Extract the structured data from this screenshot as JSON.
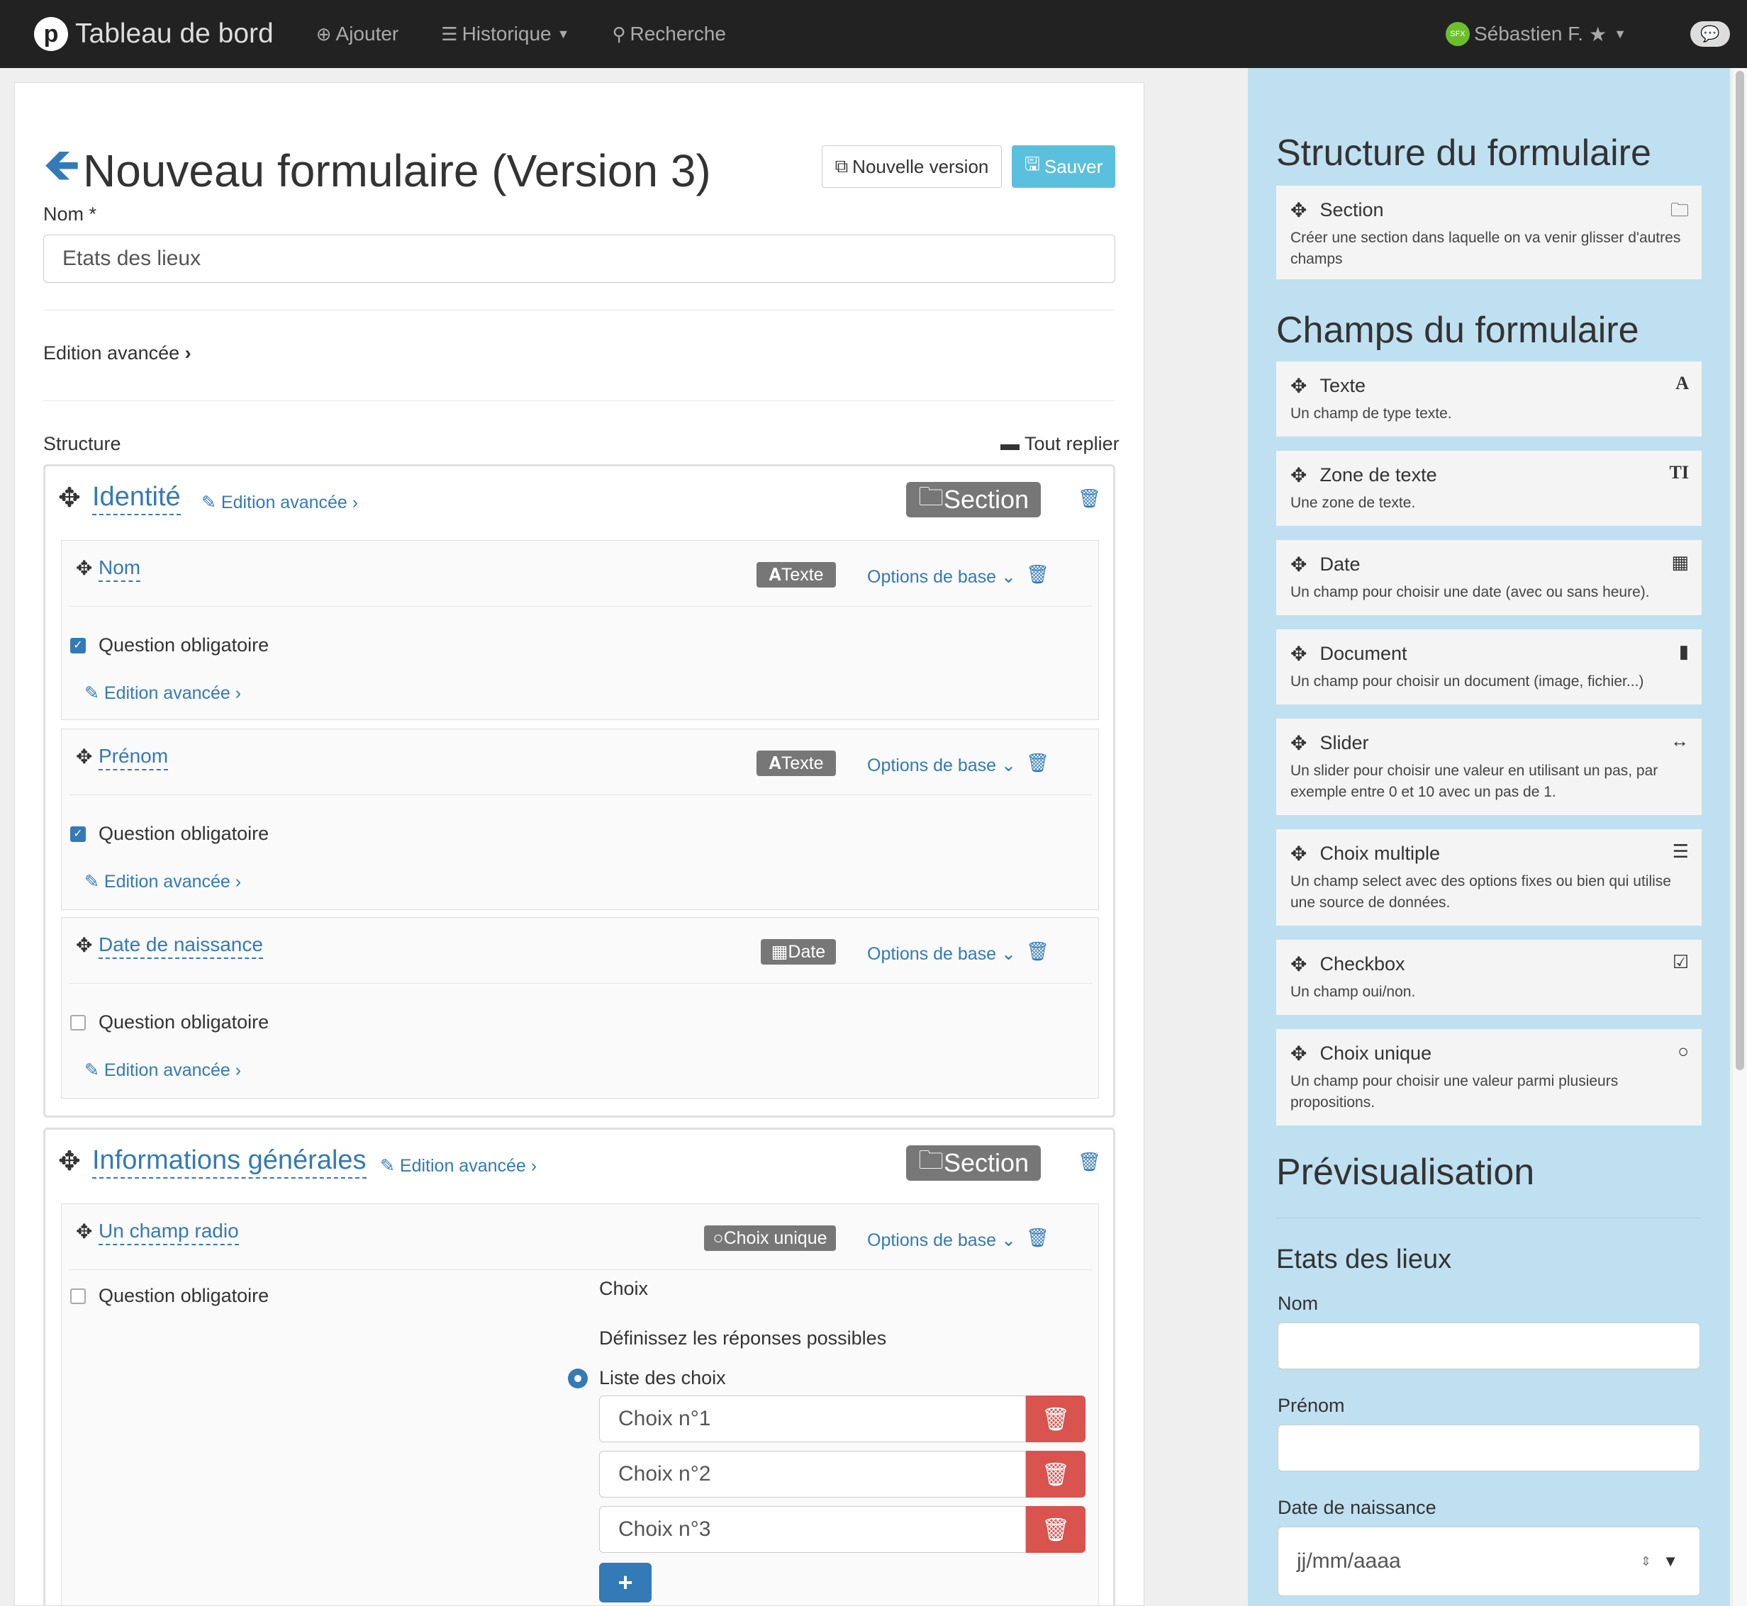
{
  "nav": {
    "brand": "Tableau de bord",
    "add": "Ajouter",
    "history": "Historique",
    "search": "Recherche",
    "user": "Sébastien F.",
    "avatar": "SFX"
  },
  "page": {
    "title": "Nouveau formulaire (Version 3)",
    "new_version": "Nouvelle version",
    "save": "Sauver",
    "name_label": "Nom",
    "name_required": "*",
    "name_value": "Etats des lieux",
    "advanced": "Edition avancée",
    "structure": "Structure",
    "collapse_all": "Tout replier"
  },
  "sections": [
    {
      "title": "Identité",
      "advanced": "Edition avancée",
      "badge": "Section",
      "fields": [
        {
          "name": "Nom",
          "type": "Texte",
          "options": "Options de base",
          "required_label": "Question obligatoire",
          "required": true,
          "advanced": "Edition avancée"
        },
        {
          "name": "Prénom",
          "type": "Texte",
          "options": "Options de base",
          "required_label": "Question obligatoire",
          "required": true,
          "advanced": "Edition avancée"
        },
        {
          "name": "Date de naissance",
          "type": "Date",
          "options": "Options de base",
          "required_label": "Question obligatoire",
          "required": false,
          "advanced": "Edition avancée"
        }
      ]
    },
    {
      "title": "Informations générales",
      "advanced": "Edition avancée",
      "badge": "Section",
      "fields": [
        {
          "name": "Un champ radio",
          "type": "Choix unique",
          "options": "Options de base",
          "required_label": "Question obligatoire",
          "required": false,
          "choices_label": "Choix",
          "choices_help": "Définissez les réponses possibles",
          "list_label": "Liste des choix",
          "choices": [
            "Choix n°1",
            "Choix n°2",
            "Choix n°3"
          ]
        }
      ]
    }
  ],
  "sidebar": {
    "structure_title": "Structure du formulaire",
    "section_card": {
      "title": "Section",
      "desc": "Créer une section dans laquelle on va venir glisser d'autres champs"
    },
    "fields_title": "Champs du formulaire",
    "fields": [
      {
        "title": "Texte",
        "desc": "Un champ de type texte.",
        "icon": "A"
      },
      {
        "title": "Zone de texte",
        "desc": "Une zone de texte.",
        "icon": "TI"
      },
      {
        "title": "Date",
        "desc": "Un champ pour choisir une date (avec ou sans heure).",
        "icon": "calendar"
      },
      {
        "title": "Document",
        "desc": "Un champ pour choisir un document (image, fichier...)",
        "icon": "file"
      },
      {
        "title": "Slider",
        "desc": "Un slider pour choisir une valeur en utilisant un pas, par exemple entre 0 et 10 avec un pas de 1.",
        "icon": "arrows-h"
      },
      {
        "title": "Choix multiple",
        "desc": "Un champ select avec des options fixes ou bien qui utilise une source de données.",
        "icon": "list"
      },
      {
        "title": "Checkbox",
        "desc": "Un champ oui/non.",
        "icon": "check-square"
      },
      {
        "title": "Choix unique",
        "desc": "Un champ pour choisir une valeur parmi plusieurs propositions.",
        "icon": "circle"
      }
    ],
    "preview_title": "Prévisualisation",
    "preview_form": "Etats des lieux",
    "preview_fields": [
      "Nom",
      "Prénom",
      "Date de naissance"
    ],
    "date_placeholder": "jj/mm/aaaa"
  }
}
